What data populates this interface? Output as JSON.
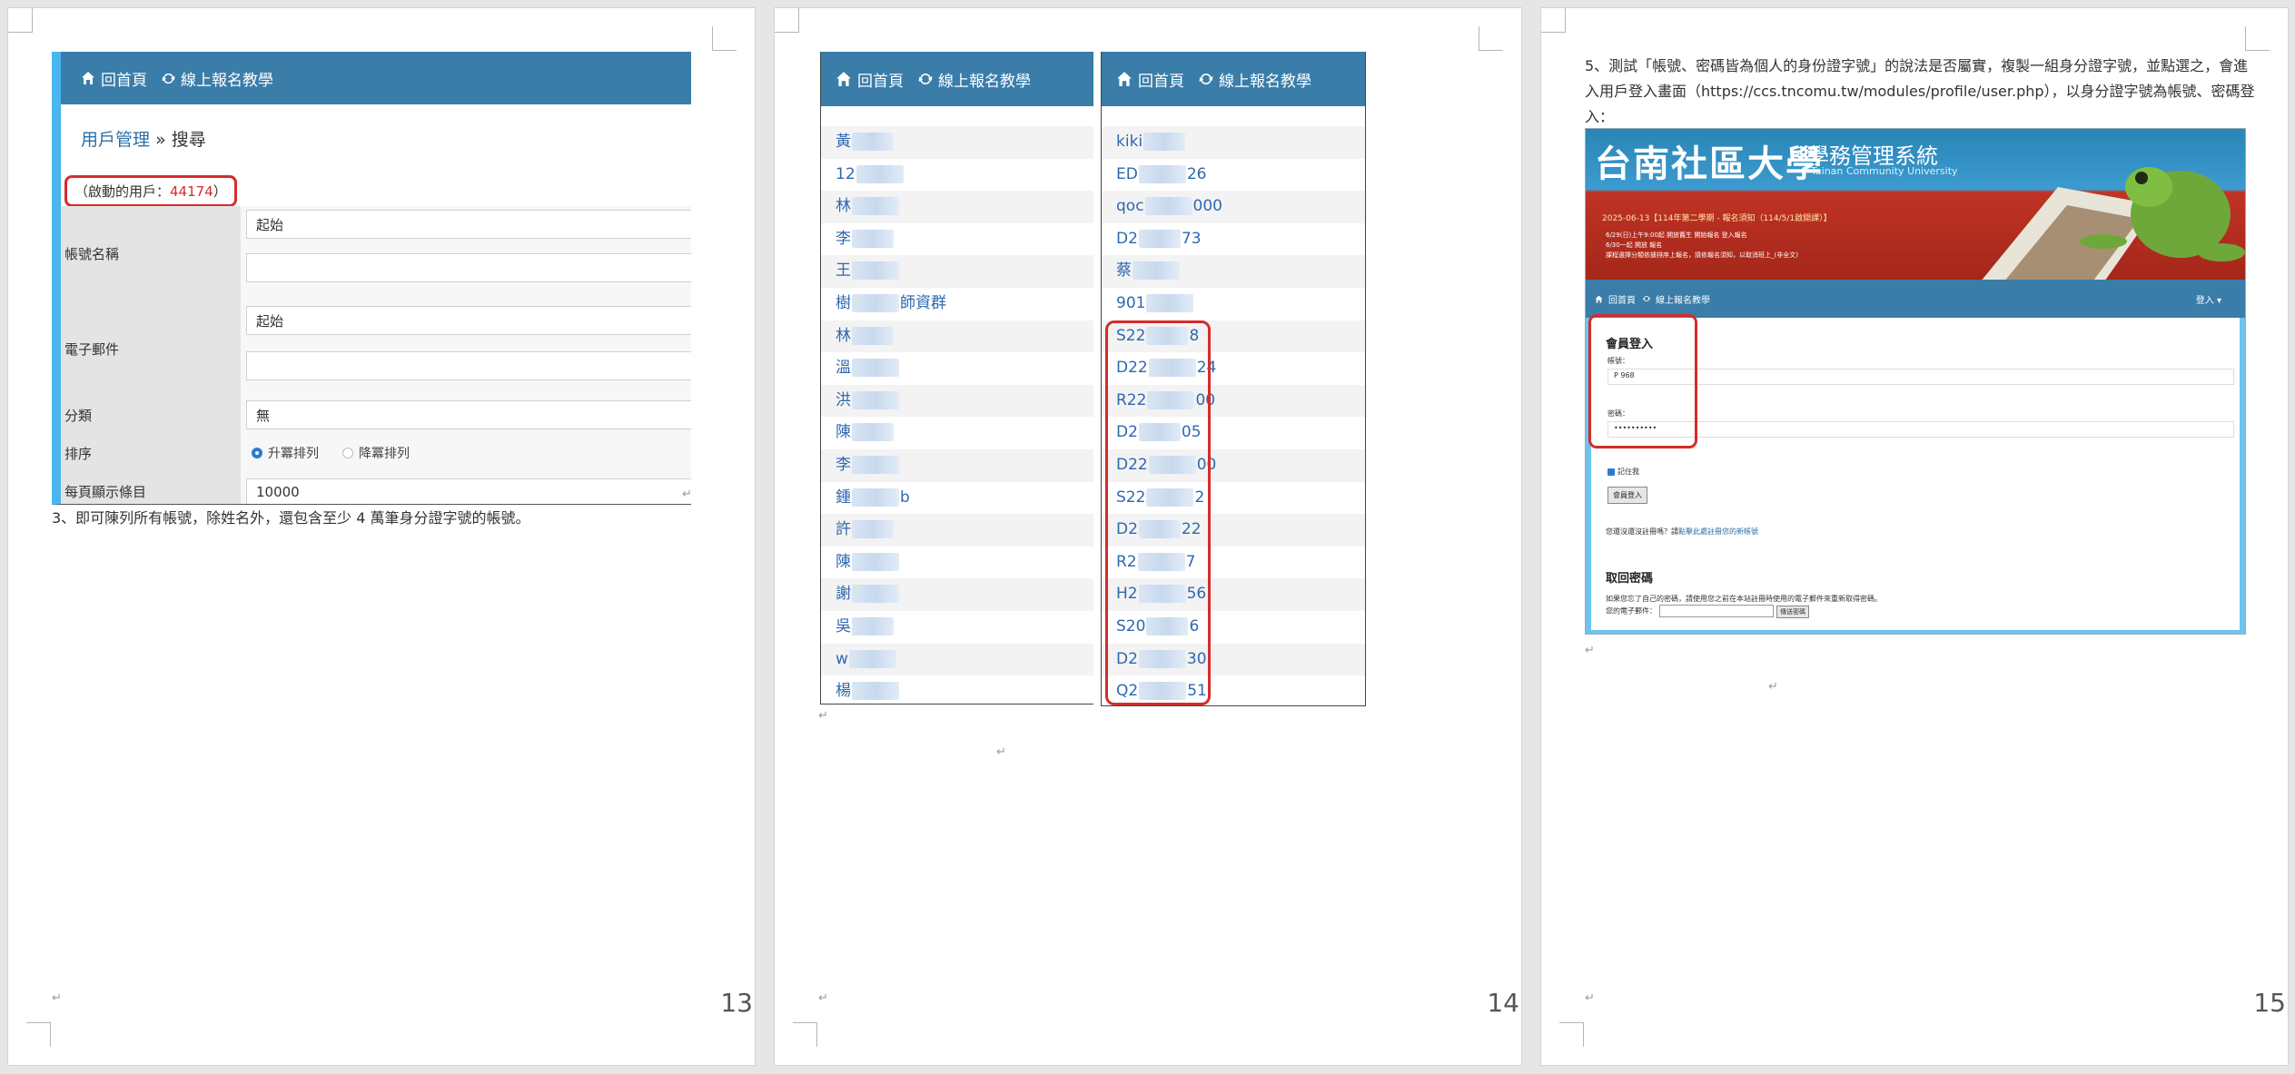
{
  "nav": {
    "home": "回首頁",
    "online": "線上報名教學"
  },
  "page13": {
    "page_number": "13",
    "breadcrumb_link": "用戶管理",
    "breadcrumb_sep": "»",
    "breadcrumb_current": "搜尋",
    "active_users_prefix": "（啟動的用戶：",
    "active_users_count": "44174",
    "active_users_suffix": "）",
    "rows": [
      {
        "label": "帳號名稱",
        "input1": "起始",
        "input2": ""
      },
      {
        "label": "電子郵件",
        "input1": "起始",
        "input2": ""
      },
      {
        "label": "分類",
        "value": "無"
      },
      {
        "label": "排序",
        "opt_asc": "升冪排列",
        "opt_desc": "降冪排列"
      },
      {
        "label": "每頁顯示條目",
        "value": "10000"
      }
    ],
    "caption": "3、即可陳列所有帳號，除姓名外，還包含至少 4 萬筆身分證字號的帳號。"
  },
  "page14": {
    "page_number": "14",
    "left_list": [
      {
        "pre": "黃",
        "post": ""
      },
      {
        "pre": "12",
        "post": ""
      },
      {
        "pre": "林",
        "post": ""
      },
      {
        "pre": "李",
        "post": ""
      },
      {
        "pre": "王",
        "post": ""
      },
      {
        "pre": "樹",
        "post": "師資群"
      },
      {
        "pre": "林",
        "post": ""
      },
      {
        "pre": "溫",
        "post": ""
      },
      {
        "pre": "洪",
        "post": ""
      },
      {
        "pre": "陳",
        "post": ""
      },
      {
        "pre": "李",
        "post": ""
      },
      {
        "pre": "鍾",
        "post": "b"
      },
      {
        "pre": "許",
        "post": ""
      },
      {
        "pre": "陳",
        "post": ""
      },
      {
        "pre": "謝",
        "post": ""
      },
      {
        "pre": "吳",
        "post": ""
      },
      {
        "pre": "w",
        "post": ""
      },
      {
        "pre": "楊",
        "post": ""
      }
    ],
    "right_list": [
      {
        "pre": "kiki",
        "post": ""
      },
      {
        "pre": "ED",
        "post": "26"
      },
      {
        "pre": "qoc",
        "post": "000"
      },
      {
        "pre": "D2",
        "post": "73"
      },
      {
        "pre": "蔡",
        "post": ""
      },
      {
        "pre": "901",
        "post": ""
      },
      {
        "pre": "S22",
        "post": "8"
      },
      {
        "pre": "D22",
        "post": "24"
      },
      {
        "pre": "R22",
        "post": "00"
      },
      {
        "pre": "D2",
        "post": "05"
      },
      {
        "pre": "D22",
        "post": "00"
      },
      {
        "pre": "S22",
        "post": "2"
      },
      {
        "pre": "D2",
        "post": "22"
      },
      {
        "pre": "R2",
        "post": "7"
      },
      {
        "pre": "H2",
        "post": "56"
      },
      {
        "pre": "S20",
        "post": "6"
      },
      {
        "pre": "D2",
        "post": "30"
      },
      {
        "pre": "Q2",
        "post": "51"
      }
    ]
  },
  "page15": {
    "page_number": "15",
    "paragraph": "5、測試「帳號、密碼皆為個人的身份證字號」的說法是否屬實，複製一組身分證字號，並點選之，會進入用戶登入畫面（https://ccs.tncomu.tw/modules/profile/user.php），以身分證字號為帳號、密碼登入：",
    "banner_title": "台南社區大學",
    "banner_subtitle": "學務管理系統",
    "banner_en": "Tainan Community University",
    "banner_news": "2025-06-13【114年第二學期 - 報名須知（114/5/1啟開課）】",
    "banner_notes": [
      "6/29(日)上午9:00起 開放舊生 開始報名 登入報名",
      "6/30一起 開放 報名",
      "課程選擇分類依據排序上報名，請依報名須知，以取消班上_(非全文)"
    ],
    "login_menu": "登入 ▾",
    "login_title": "會員登入",
    "account_label": "帳號：",
    "account_value": "P        968",
    "password_label": "密碼：",
    "password_value": "••••••••••",
    "remember": "記住我",
    "login_button": "會員登入",
    "register_text": "您還沒還沒註冊嗎？請",
    "register_link": "點擊此處註冊您的新帳號",
    "retrieve_title": "取回密碼",
    "retrieve_desc": "如果您忘了自己的密碼，請使用您之前在本站註冊時使用的電子郵件來重新取得密碼。",
    "email_label": "您的電子郵件：",
    "send_button": "傳送密碼"
  }
}
